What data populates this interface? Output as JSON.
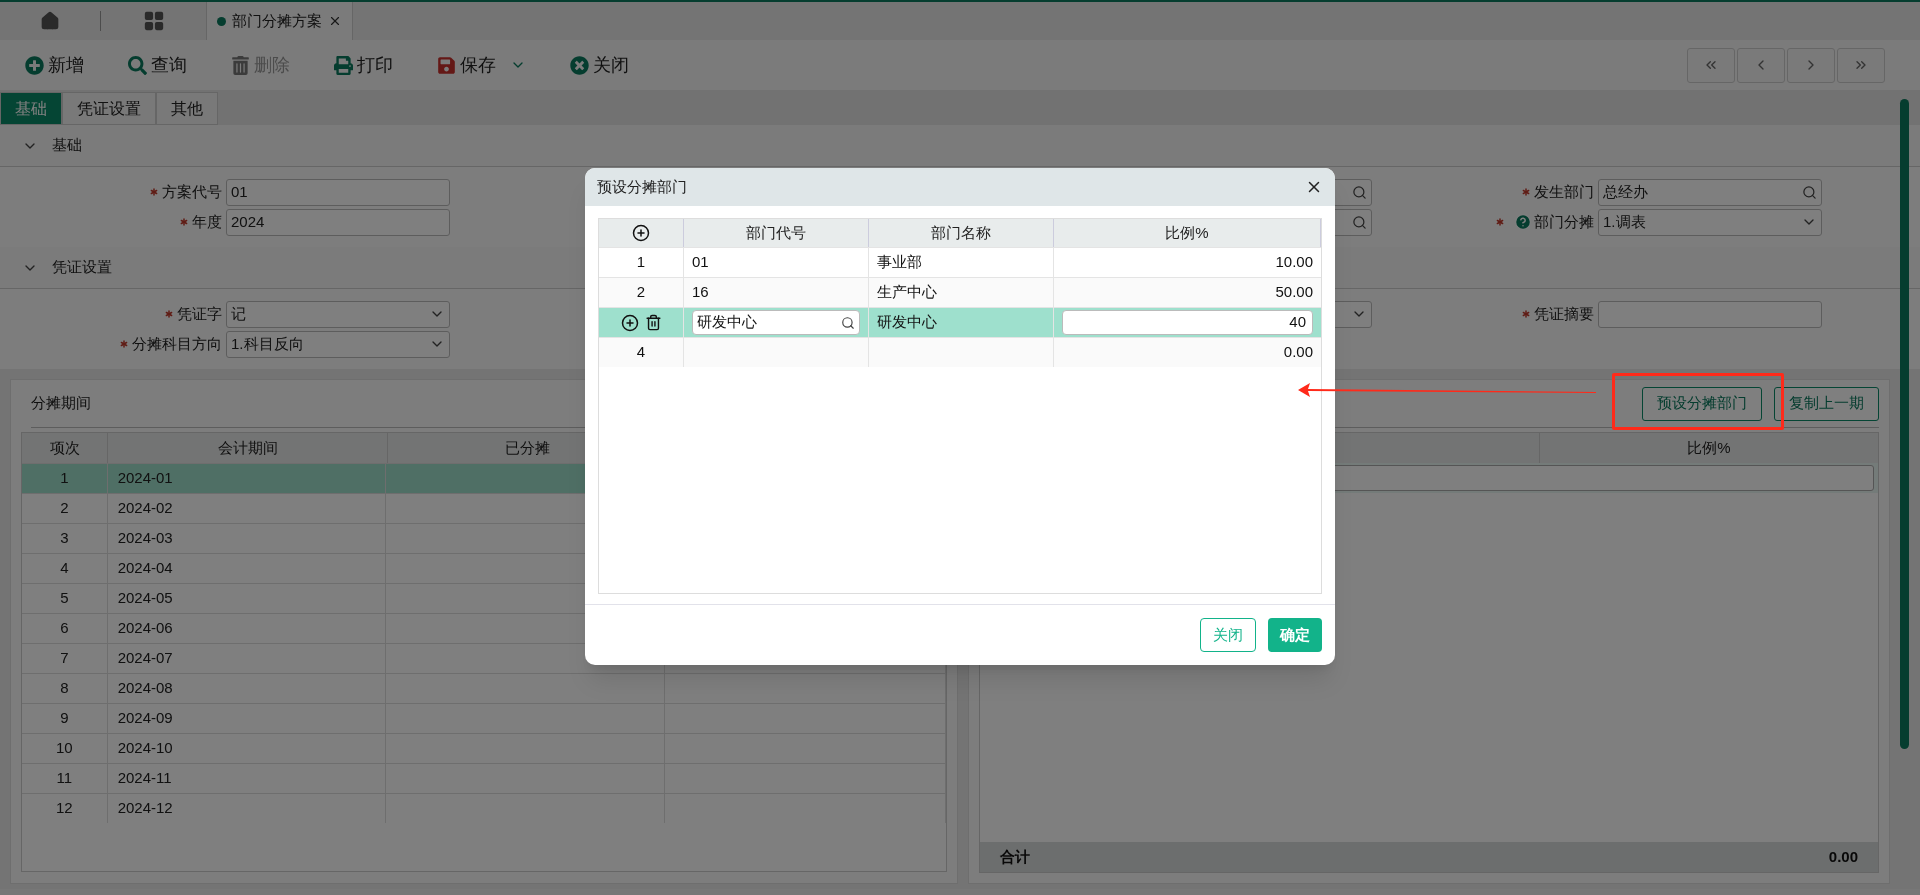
{
  "doc_tabs": [
    {
      "label": "部门分摊方案",
      "selected": true
    }
  ],
  "toolbar": [
    {
      "label": "新增",
      "kind": "add",
      "disabled": false
    },
    {
      "label": "查询",
      "kind": "search",
      "disabled": false
    },
    {
      "label": "删除",
      "kind": "delete",
      "disabled": true
    },
    {
      "label": "打印",
      "kind": "print",
      "disabled": false
    },
    {
      "label": "保存",
      "kind": "save",
      "disabled": false,
      "dropdown": true
    },
    {
      "label": "关闭",
      "kind": "close",
      "disabled": false
    }
  ],
  "page_tabs": [
    {
      "label": "基础",
      "selected": true
    },
    {
      "label": "凭证设置",
      "selected": false
    },
    {
      "label": "其他",
      "selected": false
    }
  ],
  "sections": [
    {
      "title": "基础",
      "expanded": true,
      "rows": [
        [
          {
            "label": "方案代号",
            "required": true,
            "value": "01",
            "kind": "text"
          },
          {
            "kind": "lookup"
          },
          {
            "label": "发生部门",
            "required": true,
            "value": "总经办",
            "kind": "lookup"
          }
        ],
        [
          {
            "label": "年度",
            "required": true,
            "value": "2024",
            "kind": "text"
          },
          {
            "kind": "lookup"
          },
          {
            "label": "部门分摊",
            "required": true,
            "help": true,
            "value": "1.调表",
            "kind": "select"
          }
        ]
      ]
    },
    {
      "title": "凭证设置",
      "expanded": true,
      "rows": [
        [
          {
            "label": "凭证字",
            "required": true,
            "value": "记",
            "kind": "select"
          },
          {
            "kind": "select"
          },
          {
            "label": "凭证摘要",
            "required": true,
            "kind": "text"
          }
        ],
        [
          {
            "label": "分摊科目方向",
            "required": true,
            "value": "1.科目反向",
            "kind": "select"
          }
        ]
      ]
    }
  ],
  "period_panel": {
    "title": "分摊期间",
    "columns": [
      "项次",
      "会计期间",
      "已分摊"
    ],
    "rows": [
      {
        "cells": [
          "1",
          "2024-01"
        ],
        "selected": true
      },
      {
        "cells": [
          "2",
          "2024-02"
        ],
        "selected": false
      },
      {
        "cells": [
          "3",
          "2024-03"
        ],
        "selected": false
      },
      {
        "cells": [
          "4",
          "2024-04"
        ],
        "selected": false
      },
      {
        "cells": [
          "5",
          "2024-05"
        ],
        "selected": false
      },
      {
        "cells": [
          "6",
          "2024-06"
        ],
        "selected": false
      },
      {
        "cells": [
          "7",
          "2024-07"
        ],
        "selected": false
      },
      {
        "cells": [
          "8",
          "2024-08"
        ],
        "selected": false
      },
      {
        "cells": [
          "9",
          "2024-09"
        ],
        "selected": false
      },
      {
        "cells": [
          "10",
          "2024-10"
        ],
        "selected": false
      },
      {
        "cells": [
          "11",
          "2024-11"
        ],
        "selected": false
      },
      {
        "cells": [
          "12",
          "2024-12"
        ],
        "selected": false
      }
    ]
  },
  "allocation_panel": {
    "buttons": [
      "预设分摊部门",
      "复制上一期"
    ],
    "columns": [
      "比例%"
    ],
    "total_label": "合计",
    "total": "0.00"
  },
  "dialog": {
    "title": "预设分摊部门",
    "columns": [
      "部门代号",
      "部门名称",
      "比例%"
    ],
    "rows": [
      {
        "index": "1",
        "code": "01",
        "name": "事业部",
        "ratio": "10.00",
        "editing": false
      },
      {
        "index": "2",
        "code": "16",
        "name": "生产中心",
        "ratio": "50.00",
        "editing": false
      },
      {
        "code": "研发中心",
        "name": "研发中心",
        "ratio": "40",
        "editing": true
      },
      {
        "index": "4",
        "ratio": "0.00",
        "editing": false
      }
    ],
    "buttons": [
      {
        "label": "关闭",
        "kind": "secondary"
      },
      {
        "label": "确定",
        "kind": "primary"
      }
    ]
  }
}
